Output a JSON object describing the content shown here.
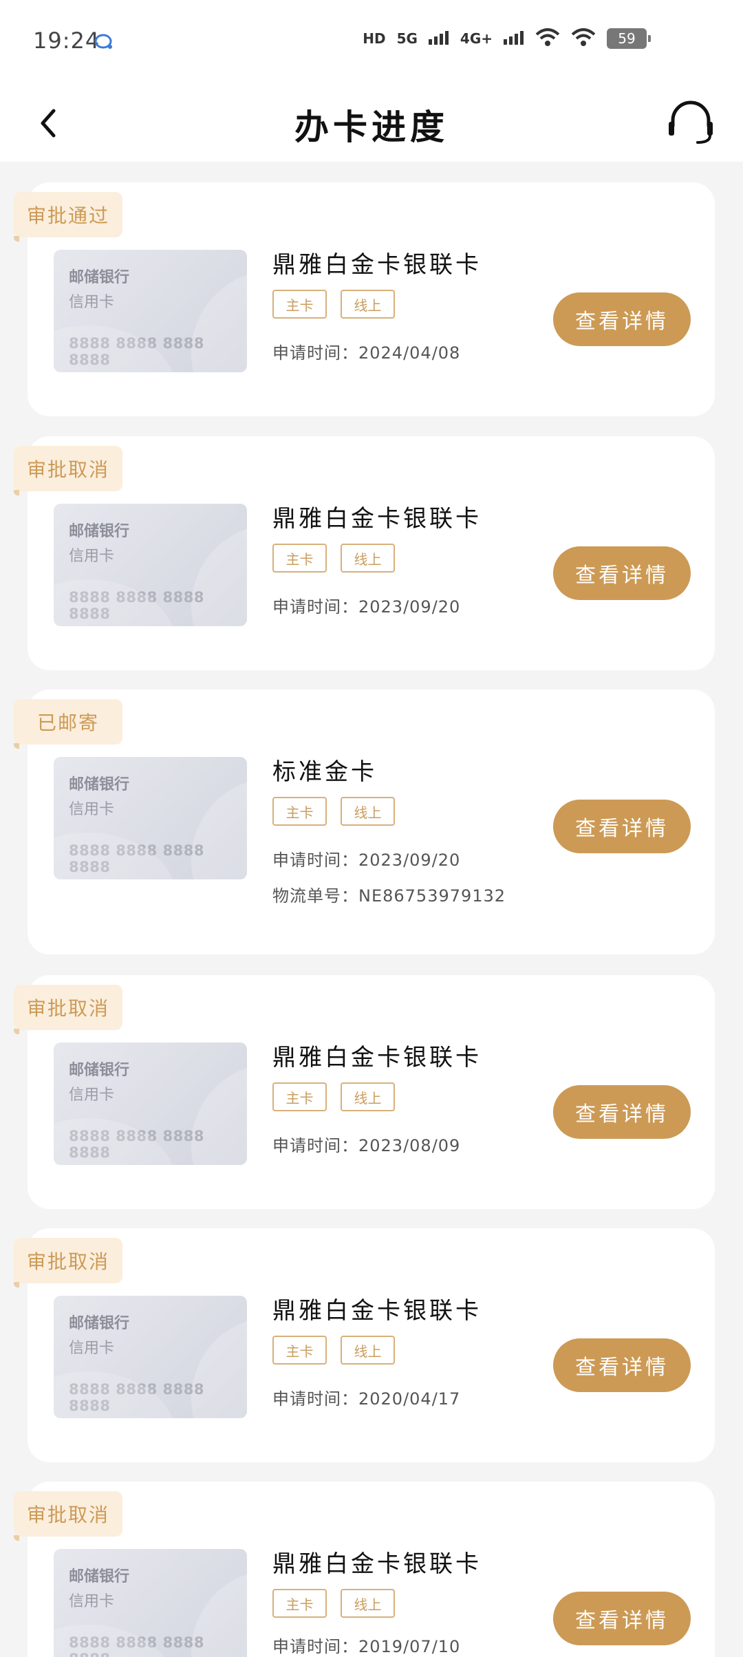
{
  "status_bar": {
    "time": "19:24",
    "network_hd": "HD",
    "network_5g": "5G",
    "network_4g": "4G+",
    "battery": "59"
  },
  "header": {
    "title": "办卡进度"
  },
  "thumbnail": {
    "bank": "邮储银行",
    "type": "信用卡",
    "number": "8888 8888 8888 8888"
  },
  "applications": [
    {
      "status": "审批通过",
      "name": "鼎雅白金卡银联卡",
      "tags": [
        "主卡",
        "线上"
      ],
      "date_line": "申请时间：2024/04/08",
      "logistics_line": "",
      "button": "查看详情"
    },
    {
      "status": "审批取消",
      "name": "鼎雅白金卡银联卡",
      "tags": [
        "主卡",
        "线上"
      ],
      "date_line": "申请时间：2023/09/20",
      "logistics_line": "",
      "button": "查看详情"
    },
    {
      "status": "已邮寄",
      "name": "标准金卡",
      "tags": [
        "主卡",
        "线上"
      ],
      "date_line": "申请时间：2023/09/20",
      "logistics_line": "物流单号：NE86753979132",
      "button": "查看详情"
    },
    {
      "status": "审批取消",
      "name": "鼎雅白金卡银联卡",
      "tags": [
        "主卡",
        "线上"
      ],
      "date_line": "申请时间：2023/08/09",
      "logistics_line": "",
      "button": "查看详情"
    },
    {
      "status": "审批取消",
      "name": "鼎雅白金卡银联卡",
      "tags": [
        "主卡",
        "线上"
      ],
      "date_line": "申请时间：2020/04/17",
      "logistics_line": "",
      "button": "查看详情"
    },
    {
      "status": "审批取消",
      "name": "鼎雅白金卡银联卡",
      "tags": [
        "主卡",
        "线上"
      ],
      "date_line": "申请时间：2019/07/10",
      "logistics_line": "",
      "button": "查看详情"
    }
  ],
  "colors": {
    "accent": "#cc9a55",
    "tag_bg": "#fbeedd",
    "page_bg": "#f4f4f4"
  }
}
